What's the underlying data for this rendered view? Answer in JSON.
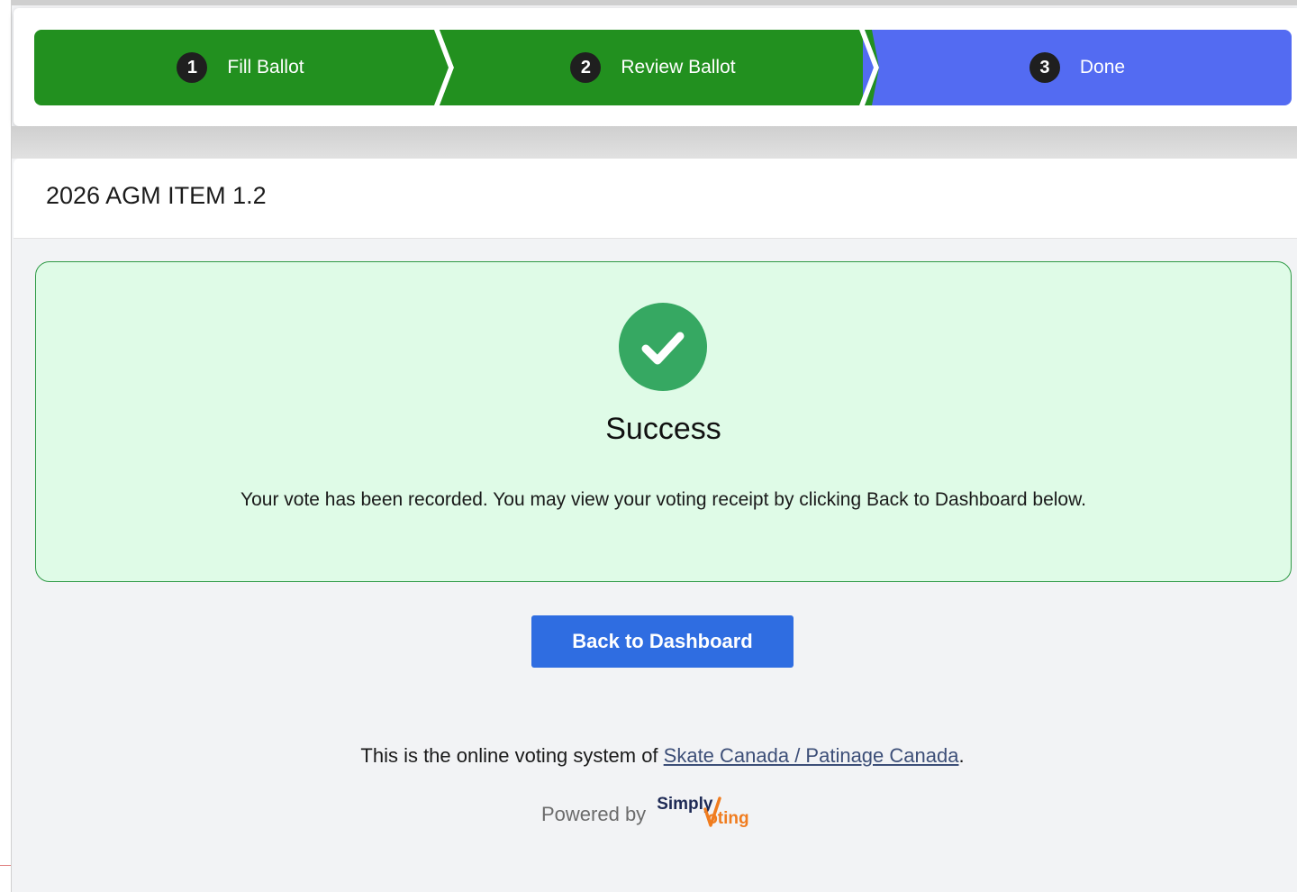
{
  "stepper": {
    "steps": [
      {
        "number": "1",
        "label": "Fill Ballot",
        "state": "complete"
      },
      {
        "number": "2",
        "label": "Review Ballot",
        "state": "complete"
      },
      {
        "number": "3",
        "label": "Done",
        "state": "active"
      }
    ],
    "colors": {
      "complete": "#22901f",
      "active": "#536bf2"
    }
  },
  "ballot": {
    "title": "2026 AGM ITEM 1.2"
  },
  "success": {
    "icon": "check-circle-icon",
    "title": "Success",
    "message": "Your vote has been recorded. You may view your voting receipt by clicking Back to Dashboard below."
  },
  "actions": {
    "back_label": "Back to Dashboard"
  },
  "footer": {
    "prefix": "This is the online voting system of ",
    "org_link": "Skate Canada / Patinage Canada",
    "suffix": ".",
    "powered_by": "Powered by",
    "logo_simply": "Simply",
    "logo_voting": "oting"
  }
}
